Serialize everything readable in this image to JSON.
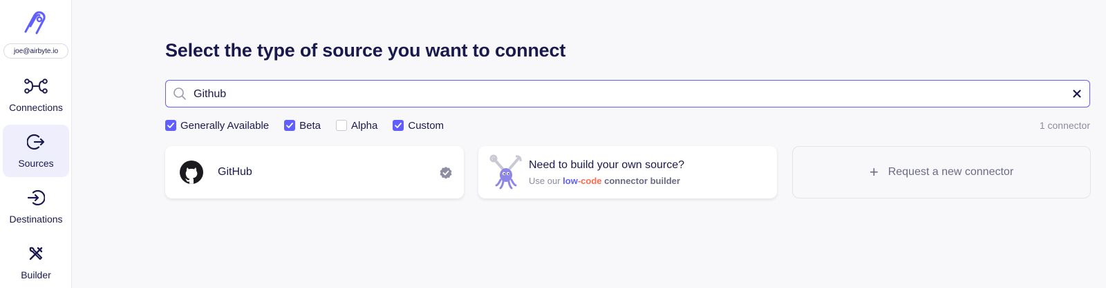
{
  "user": {
    "email": "joe@airbyte.io"
  },
  "sidebar": {
    "items": [
      {
        "label": "Connections",
        "icon": "connections-icon",
        "active": false
      },
      {
        "label": "Sources",
        "icon": "source-arrow-icon",
        "active": true
      },
      {
        "label": "Destinations",
        "icon": "destination-arrow-icon",
        "active": false
      },
      {
        "label": "Builder",
        "icon": "builder-tools-icon",
        "active": false
      }
    ]
  },
  "main": {
    "title": "Select the type of source you want to connect",
    "search": {
      "value": "Github",
      "placeholder": ""
    },
    "filters": [
      {
        "label": "Generally Available",
        "checked": true
      },
      {
        "label": "Beta",
        "checked": true
      },
      {
        "label": "Alpha",
        "checked": false
      },
      {
        "label": "Custom",
        "checked": true
      }
    ],
    "count": "1 connector",
    "cards": {
      "github": {
        "name": "GitHub"
      },
      "builder": {
        "title": "Need to build your own source?",
        "prefix": "Use our",
        "low": "low",
        "dash": "-",
        "code": "code",
        "rest": "connector builder"
      },
      "request": {
        "label": "Request a new connector"
      }
    }
  },
  "colors": {
    "accent": "#615eff",
    "text": "#1a194d",
    "background": "#f8f8fa",
    "code_orange": "#ff6a4d"
  }
}
